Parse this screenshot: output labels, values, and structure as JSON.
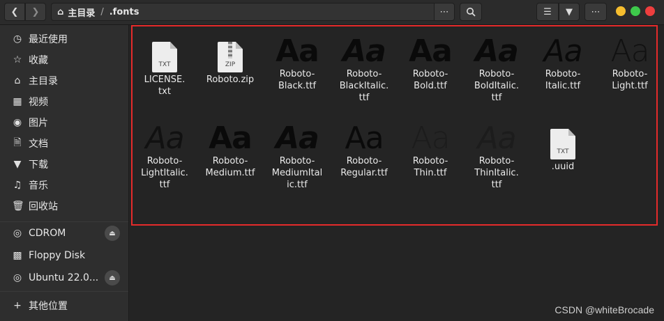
{
  "header": {
    "path_home_label": "主目录",
    "path_separator": "/",
    "path_current": ".fonts"
  },
  "sidebar": {
    "items": [
      {
        "label": "最近使用",
        "icon": "recent-icon"
      },
      {
        "label": "收藏",
        "icon": "star-icon"
      },
      {
        "label": "主目录",
        "icon": "home-icon"
      },
      {
        "label": "视频",
        "icon": "video-icon"
      },
      {
        "label": "图片",
        "icon": "camera-icon"
      },
      {
        "label": "文档",
        "icon": "document-icon"
      },
      {
        "label": "下载",
        "icon": "download-icon"
      },
      {
        "label": "音乐",
        "icon": "music-icon"
      },
      {
        "label": "回收站",
        "icon": "trash-icon"
      }
    ],
    "devices": [
      {
        "label": "CDROM",
        "icon": "disc-icon",
        "ejectable": true
      },
      {
        "label": "Floppy Disk",
        "icon": "drive-icon",
        "ejectable": false
      },
      {
        "label": "Ubuntu 22.0...",
        "icon": "disc-icon",
        "ejectable": true
      }
    ],
    "other_locations": "其他位置"
  },
  "files": [
    {
      "name": "LICENSE.\ntxt",
      "kind": "text",
      "ext": "TXT"
    },
    {
      "name": "Roboto.zip",
      "kind": "zip",
      "ext": "ZIP"
    },
    {
      "name": "Roboto-\nBlack.ttf",
      "kind": "font",
      "style": "black",
      "sample": "Aa"
    },
    {
      "name": "Roboto-\nBlackItalic.\nttf",
      "kind": "font",
      "style": "black-italic",
      "sample": "Aa"
    },
    {
      "name": "Roboto-\nBold.ttf",
      "kind": "font",
      "style": "bold",
      "sample": "Aa"
    },
    {
      "name": "Roboto-\nBoldItalic.\nttf",
      "kind": "font",
      "style": "bold-italic",
      "sample": "Aa"
    },
    {
      "name": "Roboto-\nItalic.ttf",
      "kind": "font",
      "style": "italic",
      "sample": "Aa"
    },
    {
      "name": "Roboto-\nLight.ttf",
      "kind": "font",
      "style": "light",
      "sample": "Aa"
    },
    {
      "name": "Roboto-\nLightItalic.\nttf",
      "kind": "font",
      "style": "light-italic",
      "sample": "Aa"
    },
    {
      "name": "Roboto-\nMedium.ttf",
      "kind": "font",
      "style": "medium",
      "sample": "Aa"
    },
    {
      "name": "Roboto-\nMediumItal\nic.ttf",
      "kind": "font",
      "style": "medium-italic",
      "sample": "Aa"
    },
    {
      "name": "Roboto-\nRegular.ttf",
      "kind": "font",
      "style": "regular",
      "sample": "Aa"
    },
    {
      "name": "Roboto-\nThin.ttf",
      "kind": "font",
      "style": "thin",
      "sample": "Aa"
    },
    {
      "name": "Roboto-\nThinItalic.\nttf",
      "kind": "font",
      "style": "thin-italic",
      "sample": "Aa"
    },
    {
      "name": ".uuid",
      "kind": "text",
      "ext": "TXT"
    }
  ],
  "watermark": "CSDN @whiteBrocade",
  "colors": {
    "selection_border": "#e52b2b",
    "win_minimize": "#f5bd2e",
    "win_maximize": "#3ec94b",
    "win_close": "#ee3e3e"
  }
}
